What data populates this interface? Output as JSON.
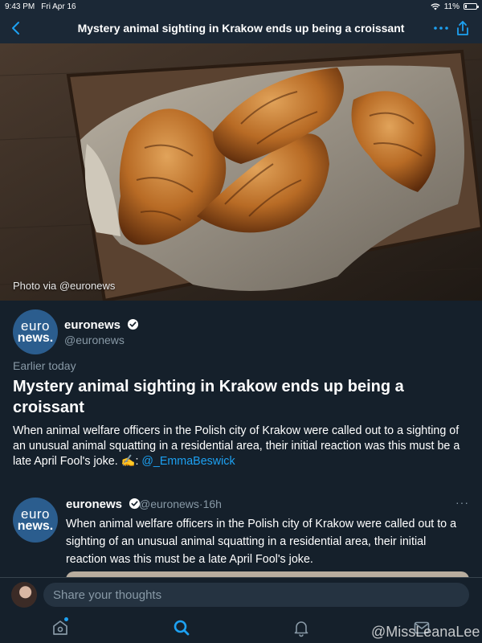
{
  "status_bar": {
    "time": "9:43 PM",
    "date": "Fri Apr 16",
    "battery": "11%",
    "wifi_icon": "wifi-icon"
  },
  "nav": {
    "title": "Mystery animal sighting in Krakow ends up being a croissant",
    "back_icon": "chevron-left-icon",
    "more_icon": "more-dots-icon",
    "share_icon": "share-icon"
  },
  "hero": {
    "caption": "Photo via @euronews",
    "image": "croissants-in-basket"
  },
  "author": {
    "avatar_line1": "euro",
    "avatar_line2": "news.",
    "name": "euronews",
    "handle": "@euronews"
  },
  "story": {
    "time_label": "Earlier today",
    "headline": "Mystery animal sighting in Krakow ends up being a croissant",
    "summary": "When animal welfare officers in the Polish city of Krakow were called out to a sighting of an unusual animal squatting in a residential area, their initial reaction was this must be a late April Fool's joke. ✍️: ",
    "mention": "@_EmmaBeswick"
  },
  "tweet": {
    "avatar_line1": "euro",
    "avatar_line2": "news.",
    "name": "euronews",
    "handle_time": "@euronews·16h",
    "more": "···",
    "text": "When animal welfare officers in the Polish city of Krakow were called out to a sighting of an unusual animal squatting in a residential area, their initial reaction was this must be a late April Fool's joke."
  },
  "reply": {
    "placeholder": "Share your thoughts"
  },
  "tabs": [
    {
      "name": "home",
      "icon": "home-icon"
    },
    {
      "name": "search",
      "icon": "search-icon"
    },
    {
      "name": "notifications",
      "icon": "bell-icon"
    },
    {
      "name": "messages",
      "icon": "mail-icon"
    }
  ],
  "watermark": "@MissLeanaLee",
  "colors": {
    "background": "#15202b",
    "accent": "#1da1f2",
    "secondary_text": "#8899a6"
  }
}
